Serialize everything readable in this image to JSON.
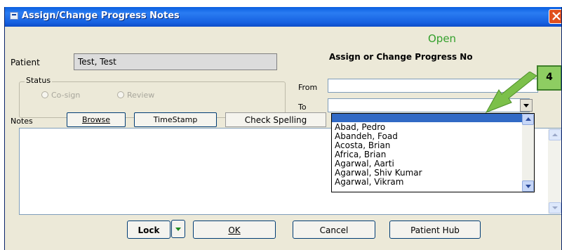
{
  "window": {
    "title": "Assign/Change Progress Notes"
  },
  "header": {
    "status_text": "Open",
    "assign_label": "Assign or Change Progress No"
  },
  "patient": {
    "label": "Patient",
    "value": "Test, Test"
  },
  "status_group": {
    "label": "Status",
    "options": [
      {
        "label": "Co-sign",
        "selected": false,
        "enabled": false
      },
      {
        "label": "Review",
        "selected": false,
        "enabled": false
      }
    ]
  },
  "from": {
    "label": "From",
    "value": ""
  },
  "to": {
    "label": "To",
    "value": ""
  },
  "notes": {
    "label": "Notes",
    "browse_label": "Browse",
    "timestamp_label": "TimeStamp",
    "spell_label": "Check Spelling",
    "content": ""
  },
  "dropdown": {
    "items": [
      "Abad, Pedro",
      "Abandeh, Foad",
      "Acosta, Brian",
      "Africa, Brian",
      "Agarwal, Aarti",
      "Agarwal, Shiv Kumar",
      "Agarwal, Vikram"
    ]
  },
  "callout": {
    "number": "4"
  },
  "footer": {
    "lock_label": "Lock",
    "ok_label": "OK",
    "cancel_label": "Cancel",
    "patient_hub_label": "Patient Hub"
  },
  "colors": {
    "title_bar": "#1660e0",
    "dialog_bg": "#ece9d8",
    "status_open": "#34a02c",
    "selection": "#316ac5",
    "callout": "#8ecd62",
    "arrow": "#7cc04a"
  }
}
